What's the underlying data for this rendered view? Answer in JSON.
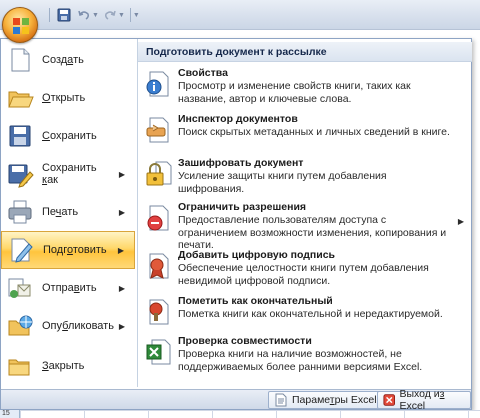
{
  "quick_access": {
    "icons": [
      "save-icon",
      "undo-icon",
      "redo-icon",
      "customize-icon"
    ]
  },
  "left_menu": {
    "items": [
      {
        "label_pre": "Созд",
        "label_u": "а",
        "label_post": "ть",
        "icon": "new-document-icon",
        "submenu": false
      },
      {
        "label_pre": "",
        "label_u": "О",
        "label_post": "ткрыть",
        "icon": "open-folder-icon",
        "submenu": false
      },
      {
        "label_pre": "",
        "label_u": "С",
        "label_post": "охранить",
        "icon": "save-icon",
        "submenu": false
      },
      {
        "label_pre": "Сохранить ",
        "label_u": "к",
        "label_post": "ак",
        "icon": "save-as-icon",
        "submenu": true
      },
      {
        "label_pre": "Пе",
        "label_u": "ч",
        "label_post": "ать",
        "icon": "print-icon",
        "submenu": true
      },
      {
        "label_pre": "Подг",
        "label_u": "о",
        "label_post": "товить",
        "icon": "prepare-icon",
        "submenu": true,
        "active": true
      },
      {
        "label_pre": "Отпра",
        "label_u": "в",
        "label_post": "ить",
        "icon": "send-icon",
        "submenu": true
      },
      {
        "label_pre": "Опу",
        "label_u": "б",
        "label_post": "ликовать",
        "icon": "publish-icon",
        "submenu": true
      },
      {
        "label_pre": "",
        "label_u": "З",
        "label_post": "акрыть",
        "icon": "close-folder-icon",
        "submenu": false
      }
    ]
  },
  "right_pane": {
    "header": "Подготовить документ к рассылке",
    "items": [
      {
        "title": "Свойства",
        "desc": "Просмотр и изменение свойств книги, таких как название, автор и ключевые слова.",
        "icon": "properties-icon",
        "submenu": false
      },
      {
        "title": "Инспектор документов",
        "desc": "Поиск скрытых метаданных и личных сведений в книге.",
        "icon": "inspect-document-icon",
        "submenu": false
      },
      {
        "title": "Зашифровать документ",
        "desc": "Усиление защиты книги путем добавления шифрования.",
        "icon": "encrypt-lock-icon",
        "submenu": false
      },
      {
        "title": "Ограничить разрешения",
        "desc": "Предоставление пользователям доступа с ограничением возможности изменения, копирования и печати.",
        "icon": "restrict-permission-icon",
        "submenu": true
      },
      {
        "title": "Добавить цифровую подпись",
        "desc": "Обеспечение целостности книги путем добавления невидимой цифровой подписи.",
        "icon": "digital-signature-icon",
        "submenu": false
      },
      {
        "title": "Пометить как окончательный",
        "desc": "Пометка книги как окончательной и нередактируемой.",
        "icon": "mark-final-icon",
        "submenu": false
      },
      {
        "title": "Проверка совместимости",
        "desc": "Проверка книги на наличие возможностей, не поддерживаемых более ранними версиями Excel.",
        "icon": "compatibility-check-icon",
        "submenu": false
      }
    ]
  },
  "footer": {
    "options_pre": "Параме",
    "options_u": "т",
    "options_post": "ры Excel",
    "exit_pre": "Выход и",
    "exit_u": "з",
    "exit_post": " Excel"
  },
  "sheet": {
    "row_number": "15"
  },
  "colors": {
    "accent_highlight": "#ffd86a",
    "header_text": "#15284b",
    "frame_border": "#8ea4c4"
  }
}
